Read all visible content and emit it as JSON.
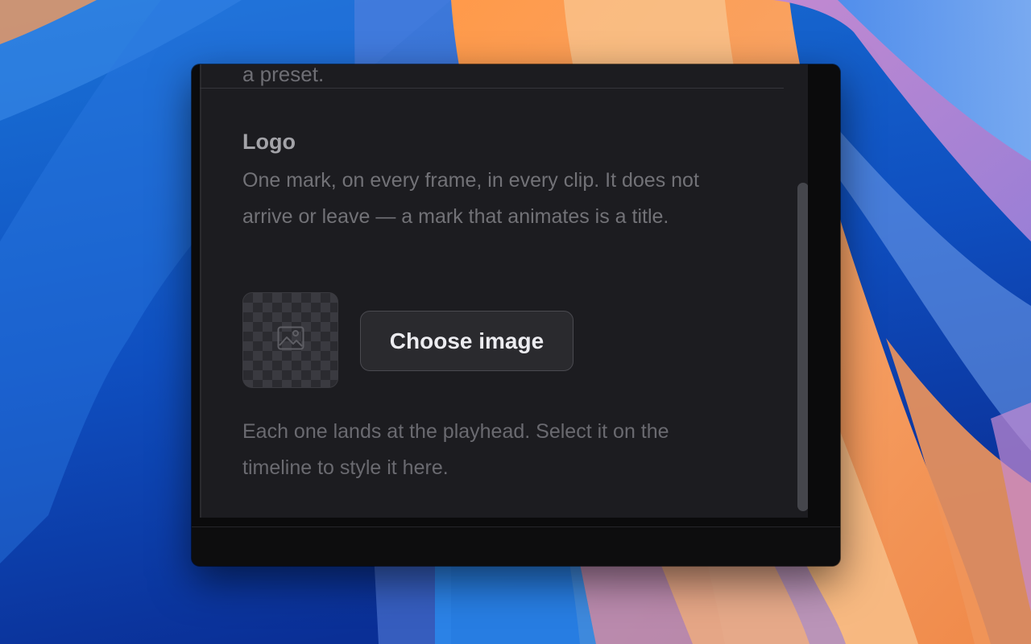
{
  "panel": {
    "previous_section_tail": "a preset.",
    "logo_section": {
      "title": "Logo",
      "description": "One mark, on every frame, in every clip. It does not arrive or leave — a mark that animates is a title.",
      "thumbnail_icon": "image-placeholder-icon",
      "choose_button_label": "Choose image"
    },
    "hint": "Each one lands at the playhead. Select it on the timeline to style it here."
  },
  "colors": {
    "panel_bg": "#1c1c20",
    "window_bg": "#0b0b0c",
    "button_bg": "#2a2a2e",
    "scroll_thumb": "#45464c"
  }
}
